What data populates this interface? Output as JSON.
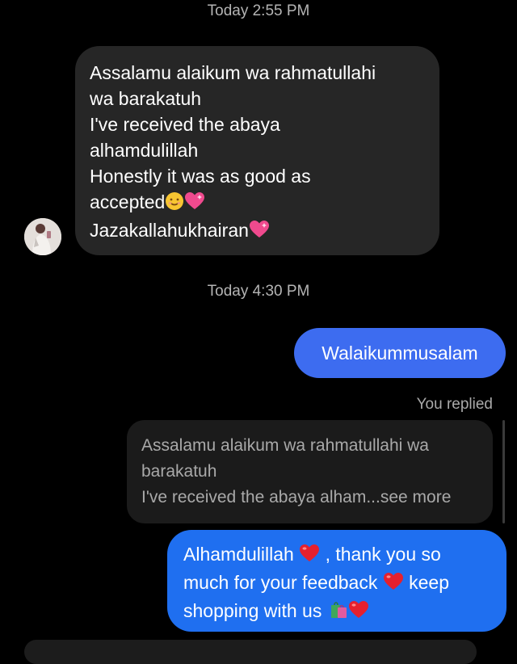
{
  "chat": {
    "timestamp_1": "Today 2:55 PM",
    "timestamp_2": "Today 4:30 PM",
    "incoming": {
      "lines": [
        "Assalamu alaikum wa rahmatullahi",
        "wa barakatuh",
        "I've received the abaya",
        "alhamdulillah",
        "Honestly it was as good as",
        "accepted",
        "Jazakallahukhairan"
      ],
      "emoji": [
        "smiling-face-icon",
        "pink-heart-icon",
        "pink-heart-icon"
      ]
    },
    "outgoing_1": "Walaikummusalam",
    "you_replied": "You replied",
    "reply_preview": {
      "lines": [
        "Assalamu alaikum wa rahmatullahi wa",
        "barakatuh",
        "I've received the abaya alham...see more"
      ]
    },
    "outgoing_2": {
      "parts": [
        "Alhamdulillah",
        ", thank you so",
        "much for your feedback",
        "keep",
        "shopping with us"
      ],
      "emoji": [
        "red-heart-icon",
        "red-heart-icon",
        "shopping-bags-icon",
        "red-heart-icon"
      ]
    }
  },
  "colors": {
    "background": "#000000",
    "incoming_bubble": "#262626",
    "outgoing_bubble": "#3d6cf0",
    "reply_preview": "#1b1b1b",
    "muted_text": "#a9a9a9"
  }
}
